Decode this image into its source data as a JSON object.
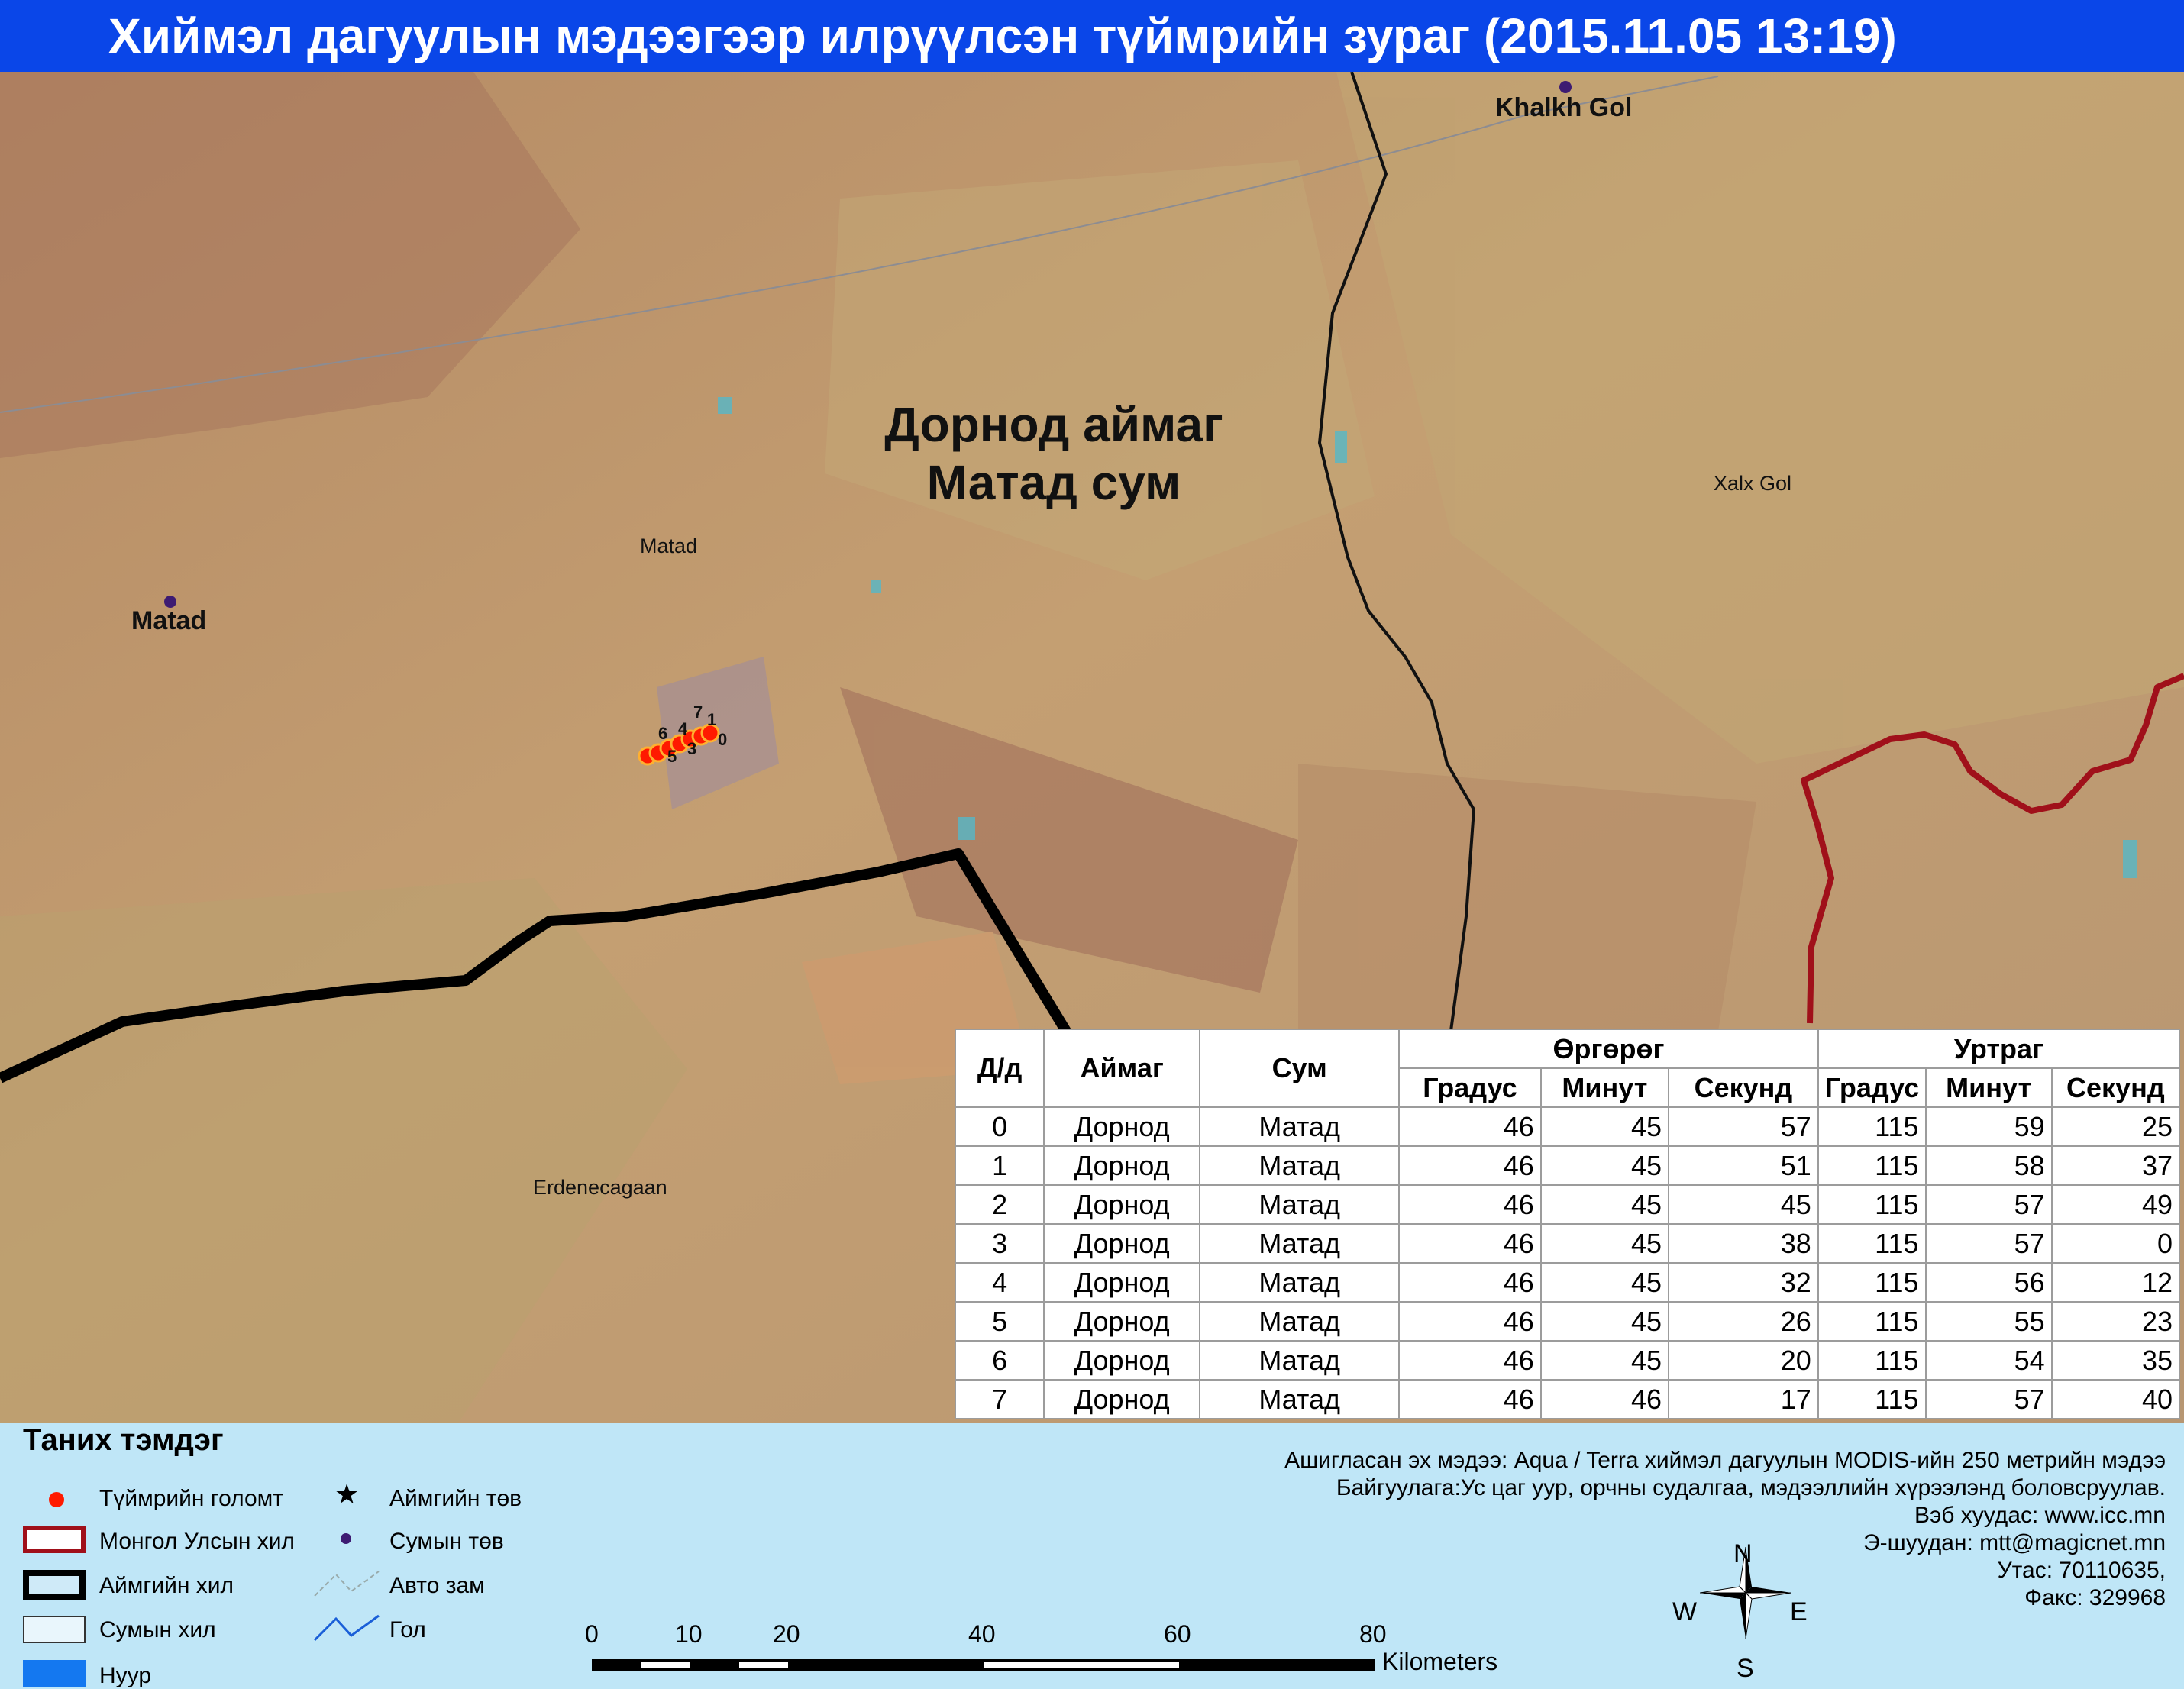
{
  "title": "Хиймэл дагуулын мэдээгээр илрүүлсэн түймрийн зураг  (2015.11.05 13:19)",
  "map": {
    "region_title_line1": "Дорнод  аймаг",
    "region_title_line2": "Матад  сум",
    "sum_centers": [
      {
        "label": "Matad"
      },
      {
        "label": "Khalkh Gol"
      }
    ],
    "sum_names": [
      {
        "label": "Matad"
      },
      {
        "label": "Xalx Gol"
      },
      {
        "label": "Erdenecagaan"
      }
    ],
    "fire_points": [
      "0",
      "1",
      "2",
      "3",
      "4",
      "5",
      "6",
      "7"
    ],
    "colors": {
      "fire": "#ff1a00",
      "country_border": "#a0101a",
      "aimag_border": "#000000",
      "sum_center": "#3d1b72"
    }
  },
  "table": {
    "headers": {
      "no": "Д/д",
      "aimag": "Аймаг",
      "sum": "Сум",
      "latitude": "Өргөрөг",
      "longitude": "Уртраг",
      "degree": "Градус",
      "minute": "Минут",
      "second": "Секунд"
    },
    "rows": [
      {
        "no": "0",
        "aimag": "Дорнод",
        "sum": "Матад",
        "lat_d": "46",
        "lat_m": "45",
        "lat_s": "57",
        "lon_d": "115",
        "lon_m": "59",
        "lon_s": "25"
      },
      {
        "no": "1",
        "aimag": "Дорнод",
        "sum": "Матад",
        "lat_d": "46",
        "lat_m": "45",
        "lat_s": "51",
        "lon_d": "115",
        "lon_m": "58",
        "lon_s": "37"
      },
      {
        "no": "2",
        "aimag": "Дорнод",
        "sum": "Матад",
        "lat_d": "46",
        "lat_m": "45",
        "lat_s": "45",
        "lon_d": "115",
        "lon_m": "57",
        "lon_s": "49"
      },
      {
        "no": "3",
        "aimag": "Дорнод",
        "sum": "Матад",
        "lat_d": "46",
        "lat_m": "45",
        "lat_s": "38",
        "lon_d": "115",
        "lon_m": "57",
        "lon_s": "0"
      },
      {
        "no": "4",
        "aimag": "Дорнод",
        "sum": "Матад",
        "lat_d": "46",
        "lat_m": "45",
        "lat_s": "32",
        "lon_d": "115",
        "lon_m": "56",
        "lon_s": "12"
      },
      {
        "no": "5",
        "aimag": "Дорнод",
        "sum": "Матад",
        "lat_d": "46",
        "lat_m": "45",
        "lat_s": "26",
        "lon_d": "115",
        "lon_m": "55",
        "lon_s": "23"
      },
      {
        "no": "6",
        "aimag": "Дорнод",
        "sum": "Матад",
        "lat_d": "46",
        "lat_m": "45",
        "lat_s": "20",
        "lon_d": "115",
        "lon_m": "54",
        "lon_s": "35"
      },
      {
        "no": "7",
        "aimag": "Дорнод",
        "sum": "Матад",
        "lat_d": "46",
        "lat_m": "46",
        "lat_s": "17",
        "lon_d": "115",
        "lon_m": "57",
        "lon_s": "40"
      }
    ]
  },
  "legend": {
    "title": "Таних тэмдэг",
    "items": {
      "fire": "Түймрийн голомт",
      "country_border": "Монгол Улсын хил",
      "aimag_border": "Аймгийн хил",
      "sum_border": "Сумын хил",
      "lake": "Нуур",
      "aimag_center": "Аймгийн төв",
      "sum_center": "Сумын төв",
      "road": "Авто зам",
      "river": "Гол"
    }
  },
  "source": {
    "line1": "Ашигласан эх мэдээ: Aqua / Terra хиймэл дагуулын MODIS-ийн 250 метрийн мэдээ",
    "line2": "Байгуулага:Ус цаг уур, орчны судалгаа, мэдээллийн хүрээлэнд боловсруулав.",
    "line3": "Вэб хуудас: www.icc.mn",
    "line4": "Э-шуудан: mtt@magicnet.mn",
    "line5": "Утас: 70110635,",
    "line6": "Факс: 329968"
  },
  "scale": {
    "ticks": [
      "0",
      "10",
      "20",
      "40",
      "60",
      "80"
    ],
    "unit": "Kilometers"
  },
  "compass": {
    "n": "N",
    "s": "S",
    "e": "E",
    "w": "W"
  }
}
